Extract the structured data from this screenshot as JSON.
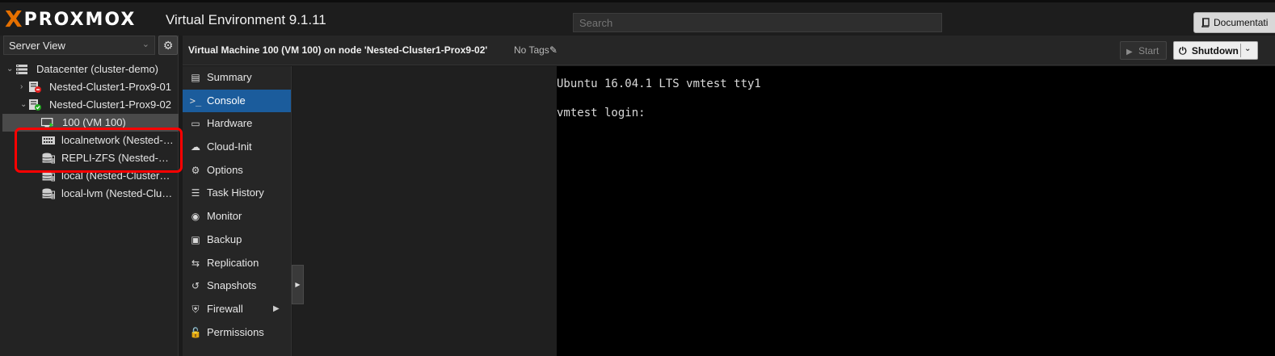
{
  "app": {
    "logo_prefix": "X",
    "logo_word": "PROXMOX",
    "version_text": "Virtual Environment 9.1.11",
    "accent_color": "#e57000"
  },
  "search": {
    "placeholder": "Search"
  },
  "toolbar": {
    "documentation_label": "Documentati",
    "documentation_icon": "book-icon"
  },
  "sidebar": {
    "view_label": "Server View",
    "tree": [
      {
        "label": "Datacenter (cluster-demo)",
        "icon": "datacenter-icon"
      },
      {
        "label": "Nested-Cluster1-Prox9-01",
        "icon": "node-offline-icon",
        "status_color": "#e02020"
      },
      {
        "label": "Nested-Cluster1-Prox9-02",
        "icon": "node-online-icon",
        "status_color": "#22aa22"
      },
      {
        "label": "100 (VM 100)",
        "icon": "vm-running-icon",
        "selected": true
      },
      {
        "label": "localnetwork (Nested-…",
        "icon": "network-icon"
      },
      {
        "label": "REPLI-ZFS (Nested-…",
        "icon": "storage-icon"
      },
      {
        "label": "local (Nested-Cluster…",
        "icon": "storage-icon"
      },
      {
        "label": "local-lvm (Nested-Clu…",
        "icon": "storage-icon"
      }
    ]
  },
  "header": {
    "title": "Virtual Machine 100 (VM 100) on node 'Nested-Cluster1-Prox9-02'",
    "tags_label": "No Tags",
    "start_label": "Start",
    "shutdown_label": "Shutdown"
  },
  "menu": [
    {
      "label": "Summary",
      "icon": "book-icon"
    },
    {
      "label": "Console",
      "icon": "terminal-icon",
      "active": true
    },
    {
      "label": "Hardware",
      "icon": "monitor-icon"
    },
    {
      "label": "Cloud-Init",
      "icon": "cloud-icon"
    },
    {
      "label": "Options",
      "icon": "gear-icon"
    },
    {
      "label": "Task History",
      "icon": "list-icon"
    },
    {
      "label": "Monitor",
      "icon": "eye-icon"
    },
    {
      "label": "Backup",
      "icon": "floppy-icon"
    },
    {
      "label": "Replication",
      "icon": "retweet-icon"
    },
    {
      "label": "Snapshots",
      "icon": "history-icon"
    },
    {
      "label": "Firewall",
      "icon": "shield-icon",
      "has_submenu": true
    },
    {
      "label": "Permissions",
      "icon": "unlock-icon"
    }
  ],
  "console": {
    "lines": [
      "Ubuntu 16.04.1 LTS vmtest tty1",
      "vmtest login:"
    ]
  },
  "colors": {
    "active_menu": "#1b5c9c",
    "highlight_box": "#ff0000"
  }
}
